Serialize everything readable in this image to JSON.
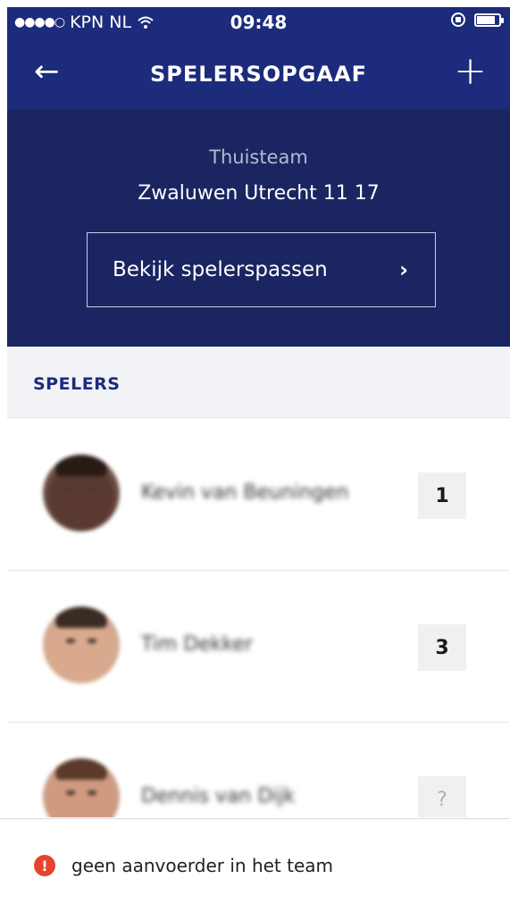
{
  "status_bar": {
    "signal": "●●●●○",
    "carrier": "KPN NL",
    "wifi_icon": "wifi-icon",
    "time": "09:48",
    "lock_icon": "rotation-lock-icon",
    "battery_icon": "battery-icon"
  },
  "navbar": {
    "back_icon": "arrow-left-icon",
    "back_glyph": "←",
    "title": "SPELERSOPGAAF",
    "add_icon": "plus-icon",
    "add_glyph": "+"
  },
  "team": {
    "label": "Thuisteam",
    "name": "Zwaluwen Utrecht 11 17",
    "pass_button_label": "Bekijk spelerspassen",
    "pass_button_icon": "chevron-right-icon",
    "pass_button_glyph": "›"
  },
  "section": {
    "title": "SPELERS"
  },
  "players": [
    {
      "name": "Kevin van Beuningen",
      "number": "1",
      "skin": "#5a3a30",
      "hair": "#2a1a14"
    },
    {
      "name": "Tim Dekker",
      "number": "3",
      "skin": "#d9a98e",
      "hair": "#3a2c24"
    },
    {
      "name": "Dennis van Dijk",
      "number": "?",
      "skin": "#d09a80",
      "hair": "#5b3a2a"
    }
  ],
  "footer": {
    "warning_icon": "alert-circle-icon",
    "warning_glyph": "!",
    "warning_text": "geen aanvoerder in het team"
  },
  "colors": {
    "navbar": "#1d2b7c",
    "team_header": "#1b2561",
    "accent_text": "#1d2b7c",
    "warning": "#e8432f"
  }
}
